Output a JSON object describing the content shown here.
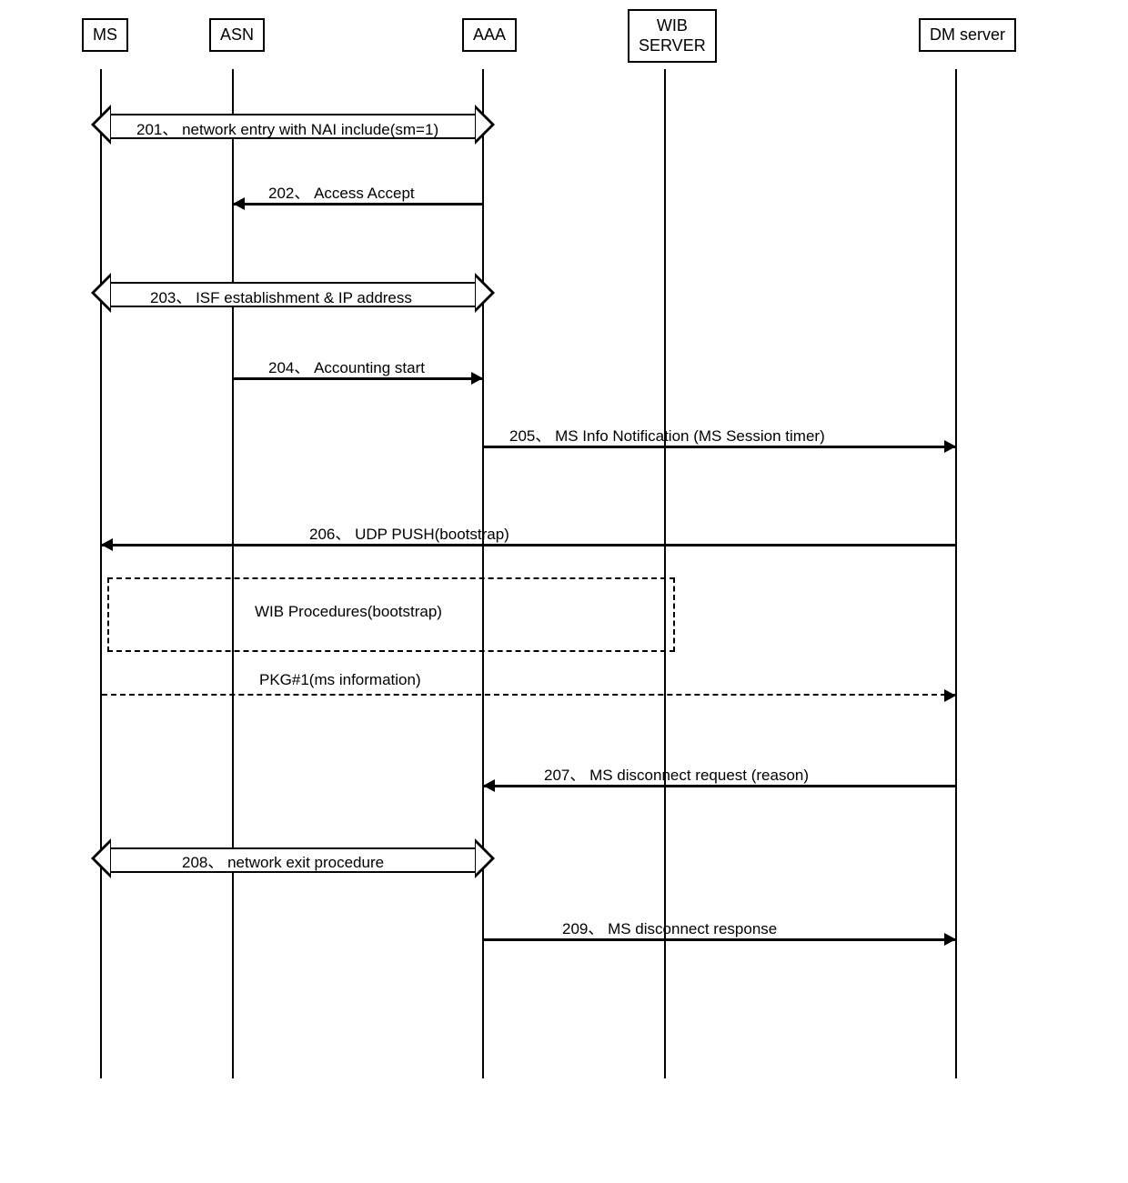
{
  "actors": {
    "ms": "MS",
    "asn": "ASN",
    "aaa": "AAA",
    "wib": "WIB\nSERVER",
    "dm": "DM server"
  },
  "messages": {
    "m201": "201、 network entry with NAI include(sm=1)",
    "m202": "202、 Access Accept",
    "m203": "203、 ISF establishment & IP address",
    "m204": "204、 Accounting start",
    "m205": "205、 MS Info Notification (MS Session timer)",
    "m206": "206、 UDP PUSH(bootstrap)",
    "wib_proc": "WIB Procedures(bootstrap)",
    "pkg1": "PKG#1(ms information)",
    "m207": "207、 MS disconnect request (reason)",
    "m208": "208、 network exit procedure",
    "m209": "209、 MS disconnect response"
  },
  "lifeline_x": {
    "ms": 40,
    "asn": 185,
    "aaa": 460,
    "wib": 660,
    "dm": 980
  }
}
